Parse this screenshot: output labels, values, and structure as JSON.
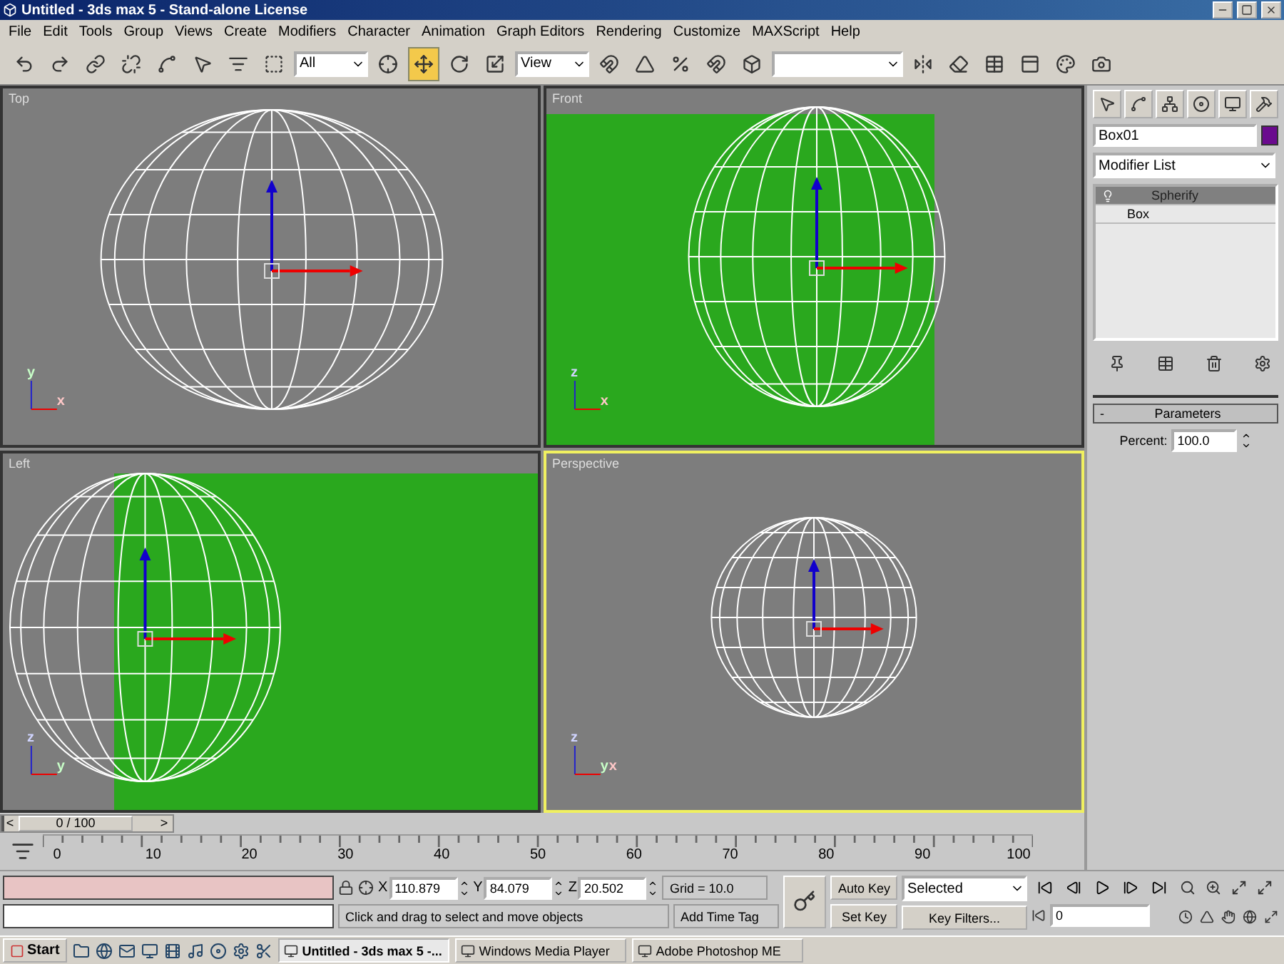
{
  "window": {
    "title": "Untitled - 3ds max 5 - Stand-alone License"
  },
  "menu": [
    "File",
    "Edit",
    "Tools",
    "Group",
    "Views",
    "Create",
    "Modifiers",
    "Character",
    "Animation",
    "Graph Editors",
    "Rendering",
    "Customize",
    "MAXScript",
    "Help"
  ],
  "toolbar": {
    "selection_filter": "All",
    "coordinate_system": "View",
    "transform_tools": [
      {
        "kind": "move",
        "selected": true
      },
      {
        "kind": "rotate",
        "selected": false
      },
      {
        "kind": "scale",
        "selected": false
      }
    ]
  },
  "viewports": [
    {
      "label": "Top",
      "active": false,
      "background_image": false,
      "axes": [
        "y",
        "x"
      ]
    },
    {
      "label": "Front",
      "active": false,
      "background_image": true,
      "axes": [
        "z",
        "x"
      ]
    },
    {
      "label": "Left",
      "active": false,
      "background_image": true,
      "axes": [
        "z",
        "y"
      ]
    },
    {
      "label": "Perspective",
      "active": true,
      "background_image": false,
      "axes": [
        "z",
        "y",
        "x"
      ]
    }
  ],
  "command_panel": {
    "object_name": "Box01",
    "color": "#6a0a8e",
    "modifier_list": "Modifier List",
    "stack": [
      {
        "label": "Spherify",
        "selected": true
      },
      {
        "label": "Box",
        "selected": false
      }
    ],
    "rollout": {
      "toggle": "-",
      "title": "Parameters",
      "percent_label": "Percent:",
      "percent": "100.0"
    }
  },
  "time_slider": {
    "prev": "<",
    "position": "0 / 100",
    "next": ">",
    "level": 0
  },
  "ruler_labels": [
    "0",
    "10",
    "20",
    "30",
    "40",
    "50",
    "60",
    "70",
    "80",
    "90",
    "100"
  ],
  "status": {
    "coords": [
      {
        "axis": "X",
        "value": "110.879"
      },
      {
        "axis": "Y",
        "value": "84.079"
      },
      {
        "axis": "Z",
        "value": "20.502"
      }
    ],
    "grid": "Grid = 10.0",
    "prompt": "Click and drag to select and move objects",
    "time_tag": "Add Time Tag"
  },
  "animation": {
    "auto_key": "Auto Key",
    "set_key": "Set Key",
    "key_mode": "Selected",
    "key_filters": "Key Filters...",
    "frame": "0"
  },
  "taskbar": {
    "start": "Start",
    "tasks": [
      {
        "label": "Untitled - 3ds max 5 -...",
        "selected": true
      },
      {
        "label": "Windows Media Player",
        "selected": false
      },
      {
        "label": "Adobe Photoshop ME",
        "selected": false
      }
    ]
  }
}
